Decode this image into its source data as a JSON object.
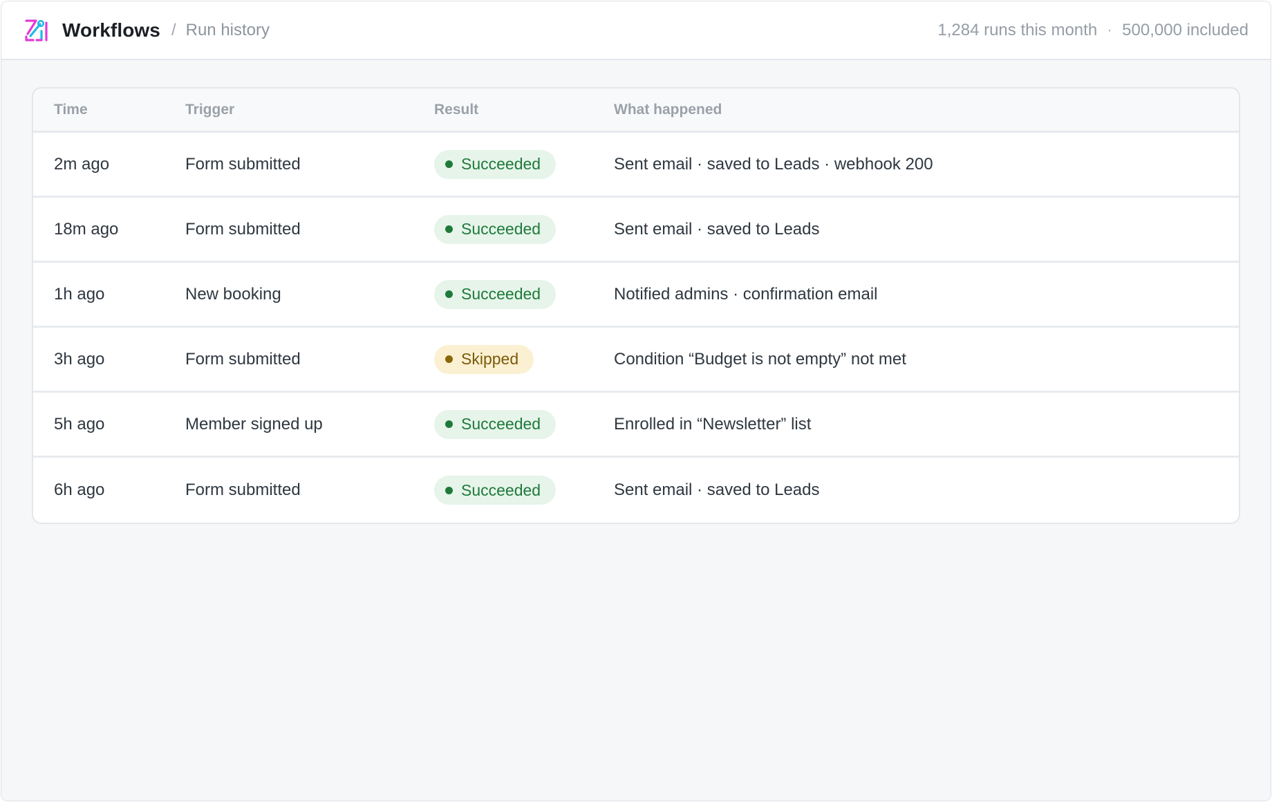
{
  "header": {
    "app_title": "Workflows",
    "separator": "/",
    "breadcrumb": "Run history",
    "runs_this_month": "1,284 runs this month",
    "usage_separator": "·",
    "included": "500,000 included"
  },
  "table": {
    "columns": [
      "Time",
      "Trigger",
      "Result",
      "What happened"
    ],
    "rows": [
      {
        "time": "2m ago",
        "trigger": "Form submitted",
        "result": "Succeeded",
        "status": "success",
        "what": "Sent email · saved to Leads · webhook 200"
      },
      {
        "time": "18m ago",
        "trigger": "Form submitted",
        "result": "Succeeded",
        "status": "success",
        "what": "Sent email · saved to Leads"
      },
      {
        "time": "1h ago",
        "trigger": "New booking",
        "result": "Succeeded",
        "status": "success",
        "what": "Notified admins · confirmation email"
      },
      {
        "time": "3h ago",
        "trigger": "Form submitted",
        "result": "Skipped",
        "status": "skipped",
        "what": "Condition “Budget is not empty” not met"
      },
      {
        "time": "5h ago",
        "trigger": "Member signed up",
        "result": "Succeeded",
        "status": "success",
        "what": "Enrolled in “Newsletter” list"
      },
      {
        "time": "6h ago",
        "trigger": "Form submitted",
        "result": "Succeeded",
        "status": "success",
        "what": "Sent email · saved to Leads"
      }
    ]
  },
  "colors": {
    "success_bg": "#e6f4ea",
    "success_fg": "#1f7a3a",
    "skipped_bg": "#fbf0d2",
    "skipped_fg": "#7a5a0a",
    "logo_pink": "#e23bd6",
    "logo_cyan": "#1fb8e6"
  },
  "icons": {
    "logo": "workflow-logo-icon"
  }
}
